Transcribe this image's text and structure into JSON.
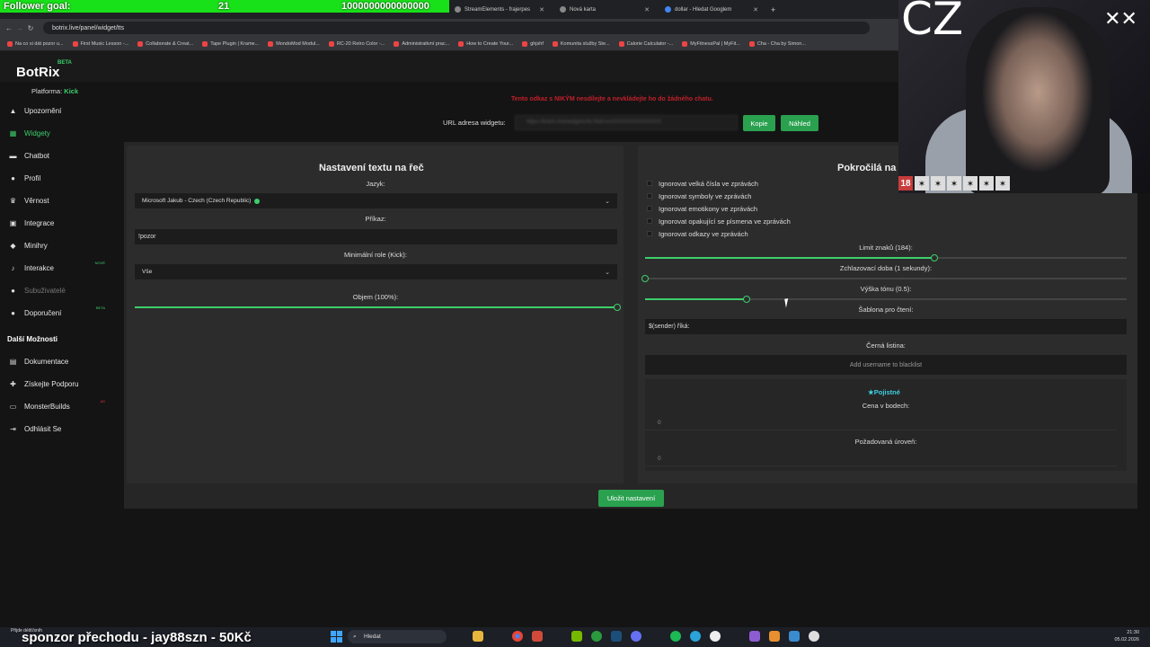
{
  "overlay": {
    "follower_label": "Follower goal:",
    "follower_current": "21",
    "follower_target": "1000000000000000"
  },
  "browser": {
    "tabs": [
      {
        "label": "StreamElements - frajerpes"
      },
      {
        "label": "Nová karta"
      },
      {
        "label": "dollar - Hledat Googlem"
      }
    ],
    "url": "botrix.live/panel/widget/tts",
    "bookmarks": [
      "Na co si dát pozor u...",
      "First Music Lesson -...",
      "Collaborate & Creat...",
      "Tape Plugin | Krame...",
      "MondoMod Modul...",
      "RC-20 Retro Color -...",
      "Administrativní prac...",
      "How to Create Your...",
      "ghjshf",
      "Komunita služby Ste...",
      "Calorie Calculator -...",
      "MyFitnessPal | MyFit...",
      "Cha - Cha by Simon..."
    ]
  },
  "app": {
    "logo": "BotRix",
    "logo_badge": "BETA",
    "platform_label": "Platforma:",
    "platform_value": "Kick",
    "sidebar": [
      {
        "label": "Upozornění",
        "icon": "bell-icon"
      },
      {
        "label": "Widgety",
        "icon": "grid-icon",
        "active": true
      },
      {
        "label": "Chatbot",
        "icon": "chat-icon"
      },
      {
        "label": "Profil",
        "icon": "user-icon"
      },
      {
        "label": "Věrnost",
        "icon": "trophy-icon"
      },
      {
        "label": "Integrace",
        "icon": "plug-icon"
      },
      {
        "label": "Minihry",
        "icon": "gamepad-icon"
      },
      {
        "label": "Interakce",
        "icon": "music-icon",
        "badge": "NOVÉ"
      },
      {
        "label": "Subuživatelé",
        "icon": "people-icon",
        "disabled": true
      },
      {
        "label": "Doporučení",
        "icon": "users-icon",
        "badge": "BETA"
      }
    ],
    "section_more": "Další Možnosti",
    "sidebar_more": [
      {
        "label": "Dokumentace",
        "icon": "doc-icon"
      },
      {
        "label": "Získejte Podporu",
        "icon": "support-icon"
      },
      {
        "label": "MonsterBuilds",
        "icon": "monitor-icon",
        "badge": "AD"
      },
      {
        "label": "Odhlásit Se",
        "icon": "logout-icon"
      }
    ],
    "warning": "Tento odkaz s NIKÝM nesdílejte a nevkládejte ho do žádného chatu.",
    "url_label": "URL adresa widgetu:",
    "url_value": "https://botrix.live/widgets/tts?bid=xxXXXXXXXXXXXXXX",
    "copy_label": "Kopie",
    "preview_label": "Náhled",
    "save_label": "Uložit nastavení"
  },
  "left": {
    "title": "Nastavení textu na řeč",
    "language_label": "Jazyk:",
    "language_value": "Microsoft Jakub - Czech (Czech Republic)",
    "command_label": "Příkaz:",
    "command_value": "!pozor",
    "role_label": "Minimální role (Kick):",
    "role_value": "Vše",
    "volume_label": "Objem (100%):",
    "volume": 1.0
  },
  "right": {
    "title": "Pokročilá na",
    "checks": [
      "Ignorovat velká čísla ve zprávách",
      "Ignorovat symboly ve zprávách",
      "Ignorovat emotikony ve zprávách",
      "Ignorovat opakující se písmena ve zprávách",
      "Ignorovat odkazy ve zprávách"
    ],
    "char_limit_label": "Limit znaků (184):",
    "char_limit": 0.6,
    "cooldown_label": "Zchlazovací doba (1 sekundy):",
    "cooldown": 0.0,
    "pitch_label": "Výška tónu (0.5):",
    "pitch": 0.21,
    "template_label": "Šablona pro čtení:",
    "template_value": "$(sender) říká:",
    "blacklist_label": "Černá listina:",
    "blacklist_placeholder": "Add username to blacklist",
    "premium_label": "Pojistné",
    "price_label": "Cena v bodech:",
    "price_value": "0",
    "level_label": "Požadovaná úroveň:",
    "level_value": "0"
  },
  "webcam": {
    "overlay_text": "CZ",
    "rating_age": "18"
  },
  "taskbar": {
    "sponsor": "sponzor přechodu - jay88szn - 50Kč",
    "weather": "Přijde déšť/sníh",
    "search_placeholder": "Hledat",
    "time": "21:30",
    "date": "05.02.2026"
  }
}
